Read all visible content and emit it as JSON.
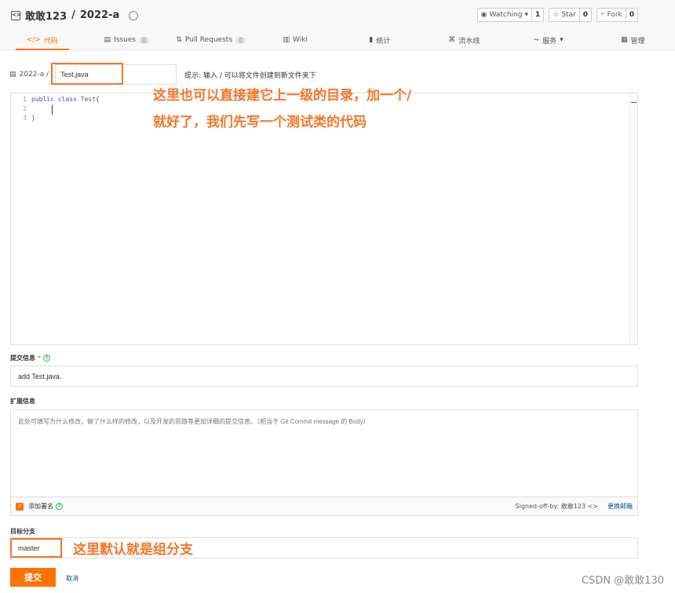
{
  "repo": {
    "owner": "敢敢123",
    "separator": "/",
    "name": "2022-a",
    "actions": [
      {
        "label": "Watching",
        "count": "1"
      },
      {
        "label": "Star",
        "count": "0"
      },
      {
        "label": "Fork",
        "count": "0"
      }
    ]
  },
  "tabs": [
    {
      "label": "代码",
      "icon": "code-icon",
      "glyph": "</>"
    },
    {
      "label": "Issues",
      "icon": "issues-icon",
      "glyph": "▤",
      "badge": "0"
    },
    {
      "label": "Pull Requests",
      "icon": "pr-icon",
      "glyph": "⇅",
      "badge": "0"
    },
    {
      "label": "Wiki",
      "icon": "wiki-icon",
      "glyph": "▥"
    },
    {
      "label": "统计",
      "icon": "stats-icon",
      "glyph": "▮"
    },
    {
      "label": "流水线",
      "icon": "pipeline-icon",
      "glyph": "⌘"
    },
    {
      "label": "服务",
      "icon": "service-icon",
      "glyph": "⏦"
    },
    {
      "label": "管理",
      "icon": "manage-icon",
      "glyph": "▦"
    }
  ],
  "path": {
    "crumb": "2022-a /",
    "filename": "Test.java",
    "hint_label": "提示:",
    "hint_text": "输入 / 可以将文件创建到新文件夹下"
  },
  "editor": {
    "lines": [
      {
        "n": "1",
        "kw1": "public",
        "kw2": "class",
        "rest": "Test{"
      },
      {
        "n": "2",
        "kw1": "",
        "kw2": "",
        "rest": ""
      },
      {
        "n": "3",
        "kw1": "",
        "kw2": "",
        "rest": "}"
      }
    ]
  },
  "commit": {
    "label": "提交信息",
    "required": "*",
    "value": "add Test.java.",
    "ext_label": "扩展信息",
    "ext_placeholder": "此处可填写为什么修改，做了什么样的修改，以及开发的思路等更加详细的提交信息。（相当于 Git Commit message 的 Body）",
    "signoff_checkbox_label": "添加署名",
    "signoff_text": "Signed-off-by: 敢敢123 <>",
    "change_email": "更换邮箱"
  },
  "branch": {
    "label": "目标分支",
    "value": "master"
  },
  "buttons": {
    "submit": "提交",
    "cancel": "取消"
  },
  "annotations": {
    "line1": "这里也可以直接建它上一级的目录，加一个/",
    "line2": "就好了，我们先写一个测试类的代码",
    "branch_note": "这里默认就是组分支"
  },
  "watermark": "CSDN @敢敢130",
  "colors": {
    "accent": "#fe7300",
    "annotation": "#f4762a",
    "keyword": "#3b4ad0",
    "link": "#005980"
  }
}
